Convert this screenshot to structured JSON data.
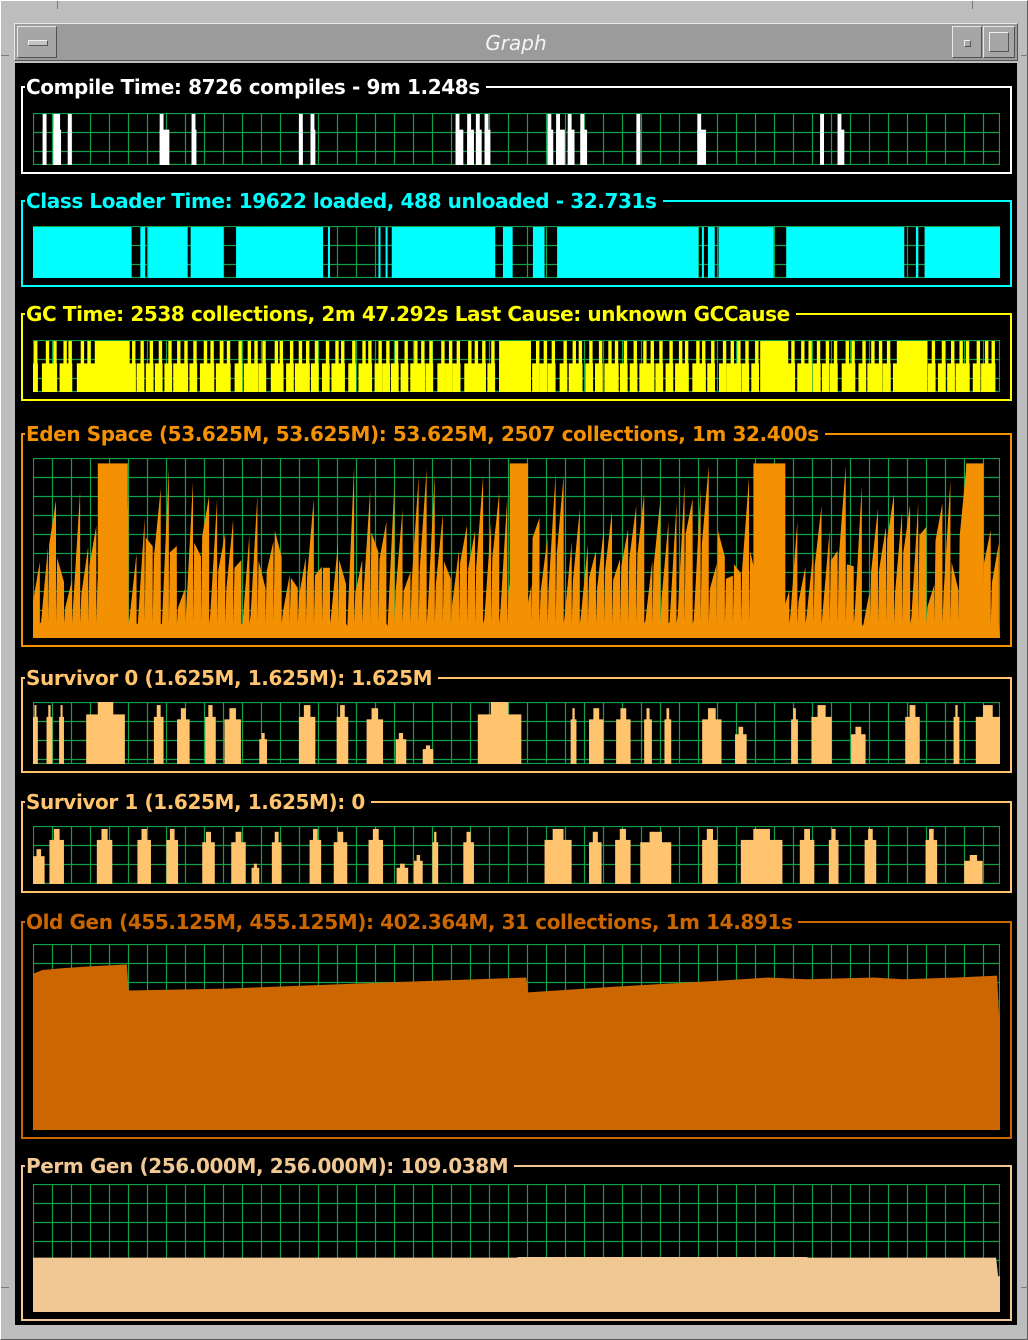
{
  "window": {
    "title": "Graph"
  },
  "grid_color": "#12a04a",
  "panels": [
    {
      "id": "compile",
      "title": "Compile Time: 8726 compiles - 9m 1.248s",
      "color": "#ffffff",
      "fill": "#ffffff",
      "chart_type": "pulses",
      "pulses": [
        [
          0.01,
          0.004
        ],
        [
          0.021,
          0.004
        ],
        [
          0.024,
          0.005
        ],
        [
          0.036,
          0.004
        ],
        [
          0.131,
          0.01
        ],
        [
          0.164,
          0.005
        ],
        [
          0.275,
          0.004
        ],
        [
          0.287,
          0.005
        ],
        [
          0.437,
          0.008
        ],
        [
          0.449,
          0.007
        ],
        [
          0.458,
          0.006
        ],
        [
          0.467,
          0.006
        ],
        [
          0.532,
          0.006
        ],
        [
          0.541,
          0.009
        ],
        [
          0.553,
          0.007
        ],
        [
          0.566,
          0.007
        ],
        [
          0.624,
          0.004
        ],
        [
          0.687,
          0.009
        ],
        [
          0.814,
          0.004
        ],
        [
          0.832,
          0.007
        ]
      ]
    },
    {
      "id": "classloader",
      "title": "Class Loader Time: 19622 loaded, 488 unloaded - 32.731s",
      "color": "#00ffff",
      "fill": "#00ffff",
      "chart_type": "blocks",
      "blocks": [
        [
          0.0,
          0.102
        ],
        [
          0.111,
          0.116
        ],
        [
          0.119,
          0.158
        ],
        [
          0.163,
          0.197
        ],
        [
          0.21,
          0.3
        ],
        [
          0.371,
          0.478
        ],
        [
          0.486,
          0.496
        ],
        [
          0.517,
          0.529
        ],
        [
          0.542,
          0.688
        ],
        [
          0.698,
          0.705
        ],
        [
          0.709,
          0.766
        ],
        [
          0.78,
          0.901
        ],
        [
          0.922,
          1.0
        ]
      ]
    },
    {
      "id": "gc",
      "title": "GC Time: 2538 collections, 2m 47.292s  Last Cause: unknown GCCause",
      "color": "#ffff00",
      "fill": "#ffff00",
      "chart_type": "dense_pulses",
      "dense_pulses": {
        "seed": 7,
        "count": 110,
        "blocks": [
          [
            0.065,
            0.1
          ],
          [
            0.482,
            0.515
          ],
          [
            0.752,
            0.781
          ],
          [
            0.894,
            0.925
          ]
        ]
      }
    },
    {
      "id": "eden",
      "title": "Eden Space (53.625M, 53.625M): 53.625M, 2507 collections, 1m 32.400s",
      "color": "#f49103",
      "fill": "#f49103",
      "chart_type": "sawtooth",
      "sawtooth": {
        "seed": 11,
        "count": 120,
        "min": 0.25,
        "max": 0.97,
        "full_blocks": [
          [
            0.067,
            0.098
          ],
          [
            0.493,
            0.512
          ],
          [
            0.745,
            0.778
          ],
          [
            0.965,
            0.983
          ]
        ]
      }
    },
    {
      "id": "survivor0",
      "title": "Survivor 0 (1.625M, 1.625M): 1.625M",
      "color": "#ffc46d",
      "fill": "#ffc46d",
      "chart_type": "blocks_h",
      "blocks_h": [
        [
          0.0,
          0.005,
          0.95
        ],
        [
          0.014,
          0.02,
          0.95
        ],
        [
          0.027,
          0.032,
          0.95
        ],
        [
          0.055,
          0.095,
          1.0
        ],
        [
          0.125,
          0.135,
          0.95
        ],
        [
          0.149,
          0.162,
          0.9
        ],
        [
          0.178,
          0.189,
          0.95
        ],
        [
          0.198,
          0.215,
          0.9
        ],
        [
          0.234,
          0.242,
          0.5
        ],
        [
          0.275,
          0.292,
          0.95
        ],
        [
          0.314,
          0.326,
          0.95
        ],
        [
          0.345,
          0.362,
          0.9
        ],
        [
          0.375,
          0.386,
          0.5
        ],
        [
          0.403,
          0.414,
          0.3
        ],
        [
          0.46,
          0.505,
          1.0
        ],
        [
          0.556,
          0.562,
          0.9
        ],
        [
          0.575,
          0.59,
          0.9
        ],
        [
          0.603,
          0.618,
          0.9
        ],
        [
          0.632,
          0.64,
          0.9
        ],
        [
          0.653,
          0.66,
          0.9
        ],
        [
          0.692,
          0.712,
          0.9
        ],
        [
          0.726,
          0.738,
          0.6
        ],
        [
          0.784,
          0.791,
          0.9
        ],
        [
          0.805,
          0.826,
          0.95
        ],
        [
          0.846,
          0.861,
          0.6
        ],
        [
          0.902,
          0.917,
          0.95
        ],
        [
          0.952,
          0.958,
          0.95
        ],
        [
          0.975,
          1.0,
          0.95
        ]
      ]
    },
    {
      "id": "survivor1",
      "title": "Survivor 1 (1.625M, 1.625M): 0",
      "color": "#ffc46d",
      "fill": "#ffc46d",
      "chart_type": "blocks_h",
      "blocks_h": [
        [
          0.0,
          0.012,
          0.6
        ],
        [
          0.017,
          0.032,
          0.95
        ],
        [
          0.066,
          0.082,
          0.95
        ],
        [
          0.108,
          0.122,
          0.95
        ],
        [
          0.138,
          0.15,
          0.95
        ],
        [
          0.175,
          0.188,
          0.9
        ],
        [
          0.205,
          0.22,
          0.9
        ],
        [
          0.226,
          0.234,
          0.35
        ],
        [
          0.247,
          0.257,
          0.9
        ],
        [
          0.286,
          0.298,
          0.95
        ],
        [
          0.311,
          0.325,
          0.9
        ],
        [
          0.347,
          0.362,
          0.95
        ],
        [
          0.376,
          0.388,
          0.35
        ],
        [
          0.394,
          0.403,
          0.5
        ],
        [
          0.413,
          0.419,
          0.9
        ],
        [
          0.445,
          0.456,
          0.9
        ],
        [
          0.529,
          0.557,
          0.95
        ],
        [
          0.575,
          0.588,
          0.9
        ],
        [
          0.602,
          0.618,
          0.95
        ],
        [
          0.628,
          0.66,
          0.9
        ],
        [
          0.692,
          0.708,
          0.95
        ],
        [
          0.732,
          0.775,
          0.95
        ],
        [
          0.793,
          0.808,
          0.95
        ],
        [
          0.823,
          0.833,
          0.95
        ],
        [
          0.86,
          0.872,
          0.95
        ],
        [
          0.923,
          0.935,
          0.95
        ],
        [
          0.963,
          0.982,
          0.5
        ]
      ]
    },
    {
      "id": "oldgen",
      "title": "Old Gen (455.125M, 455.125M): 402.364M, 31 collections, 1m 14.891s",
      "color": "#cc6600",
      "fill": "#cc6600",
      "chart_type": "area",
      "area": [
        [
          0.0,
          0.84
        ],
        [
          0.01,
          0.86
        ],
        [
          0.03,
          0.87
        ],
        [
          0.06,
          0.88
        ],
        [
          0.097,
          0.89
        ],
        [
          0.099,
          0.75
        ],
        [
          0.2,
          0.76
        ],
        [
          0.3,
          0.78
        ],
        [
          0.4,
          0.8
        ],
        [
          0.51,
          0.82
        ],
        [
          0.512,
          0.74
        ],
        [
          0.6,
          0.77
        ],
        [
          0.7,
          0.8
        ],
        [
          0.76,
          0.82
        ],
        [
          0.8,
          0.81
        ],
        [
          0.87,
          0.82
        ],
        [
          0.9,
          0.81
        ],
        [
          0.955,
          0.82
        ],
        [
          0.997,
          0.83
        ],
        [
          0.999,
          0.62
        ],
        [
          1.0,
          0.62
        ]
      ]
    },
    {
      "id": "permgen",
      "title": "Perm Gen (256.000M, 256.000M): 109.038M",
      "color": "#f1c794",
      "fill": "#f1c794",
      "chart_type": "area",
      "area": [
        [
          0.0,
          0.425
        ],
        [
          0.5,
          0.425
        ],
        [
          0.502,
          0.43
        ],
        [
          0.8,
          0.43
        ],
        [
          0.802,
          0.425
        ],
        [
          0.996,
          0.425
        ],
        [
          0.998,
          0.28
        ],
        [
          1.0,
          0.28
        ]
      ]
    }
  ]
}
